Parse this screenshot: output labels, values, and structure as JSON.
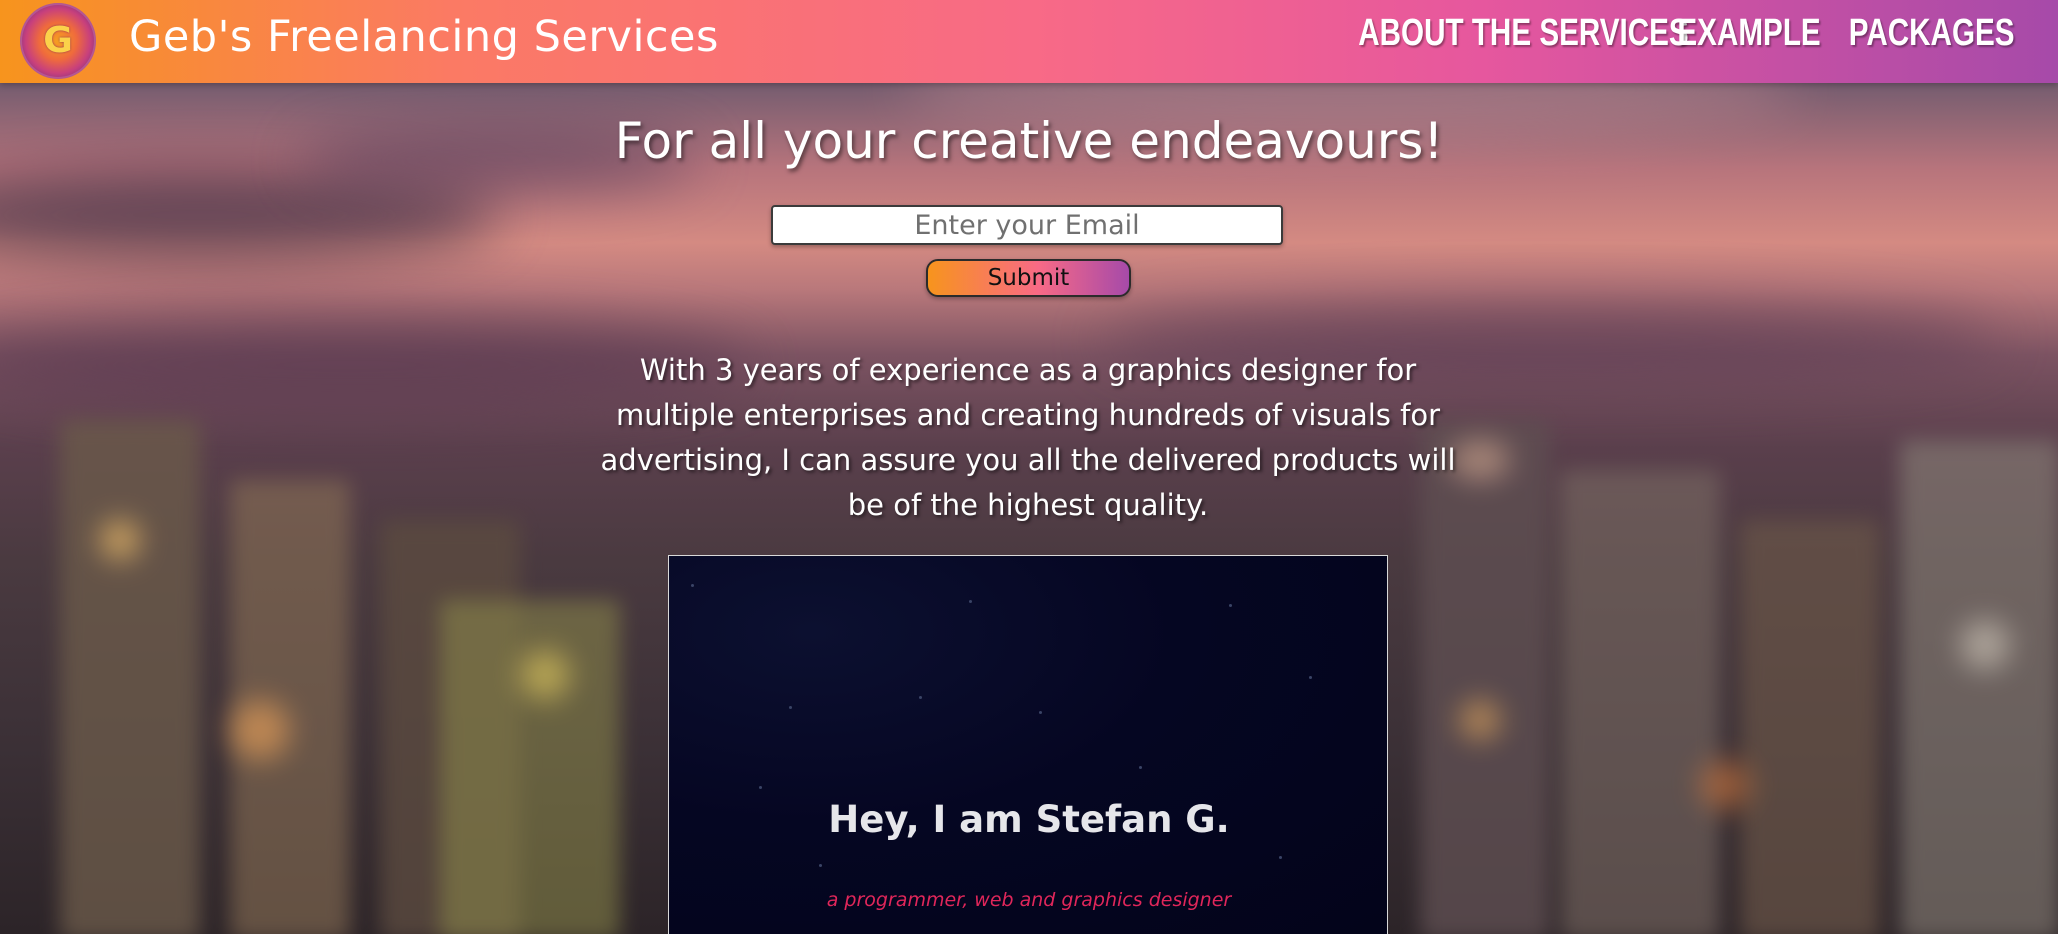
{
  "header": {
    "logo_letter": "G",
    "brand": "Geb's Freelancing Services",
    "nav": [
      {
        "label": "About the services"
      },
      {
        "label": "Example"
      },
      {
        "label": "Packages"
      }
    ]
  },
  "hero": {
    "title": "For all your creative endeavours!",
    "email_placeholder": "Enter your Email",
    "submit_label": "Submit",
    "pitch": "With 3 years of experience as a graphics designer for multiple enterprises and creating hundreds of visuals for advertising, I can assure you all the delivered products will be of the highest quality."
  },
  "embed": {
    "title": "Hey, I am Stefan G.",
    "subtitle": "a programmer, web and graphics designer"
  },
  "colors": {
    "header_gradient": [
      "#f7941d",
      "#f86a86",
      "#a64aa9"
    ],
    "subtitle_accent": "#e0265a",
    "embed_background": "#03041a"
  }
}
